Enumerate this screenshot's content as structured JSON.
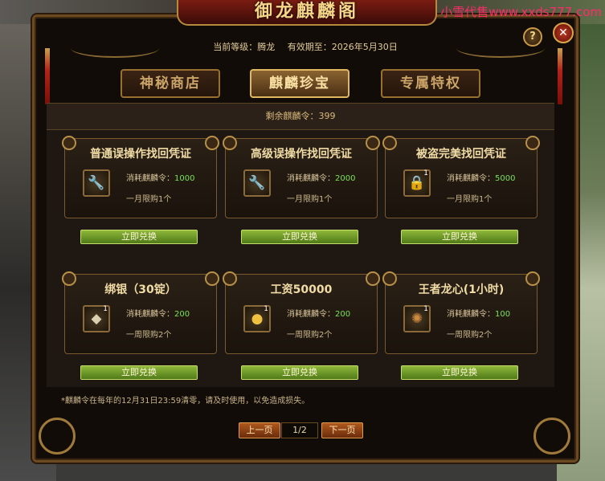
{
  "watermark": "小雪代售www.xxds777.com",
  "window": {
    "title": "御龙麒麟阁"
  },
  "header": {
    "level_label": "当前等级：腾龙",
    "expire_label": "有效期至：2026年5月30日",
    "help": "?",
    "close": "✕"
  },
  "tabs": [
    {
      "label": "神秘商店"
    },
    {
      "label": "麒麟珍宝"
    },
    {
      "label": "专属特权"
    }
  ],
  "balance": "剩余麒麟令：399",
  "items": [
    {
      "title": "普通误操作找回凭证",
      "cost_label": "消耗麒麟令：",
      "cost": "1000",
      "limit": "一月限购1个",
      "icon": "🔧",
      "button": "立即兑换"
    },
    {
      "title": "高级误操作找回凭证",
      "cost_label": "消耗麒麟令：",
      "cost": "2000",
      "limit": "一月限购1个",
      "icon": "🔧",
      "button": "立即兑换"
    },
    {
      "title": "被盗完美找回凭证",
      "cost_label": "消耗麒麟令：",
      "cost": "5000",
      "limit": "一月限购1个",
      "icon": "🔒",
      "badge": "1",
      "button": "立即兑换"
    },
    {
      "title": "绑银（30锭）",
      "cost_label": "消耗麒麟令：",
      "cost": "200",
      "limit": "一周限购2个",
      "icon": "◆",
      "badge": "1",
      "button": "立即兑换"
    },
    {
      "title": "工资50000",
      "cost_label": "消耗麒麟令：",
      "cost": "200",
      "limit": "一周限购2个",
      "icon": "●",
      "badge": "1",
      "button": "立即兑换"
    },
    {
      "title": "王者龙心(1小时)",
      "cost_label": "消耗麒麟令：",
      "cost": "100",
      "limit": "一周限购2个",
      "icon": "✺",
      "badge": "1",
      "button": "立即兑换"
    }
  ],
  "note": "*麒麟令在每年的12月31日23:59清零，请及时使用，以免造成损失。",
  "pagination": {
    "prev": "上一页",
    "page": "1/2",
    "next": "下一页"
  },
  "colors": {
    "accent_green": "#7be05a",
    "button_green": "#6b9a28",
    "title_gold": "#f6d689"
  }
}
